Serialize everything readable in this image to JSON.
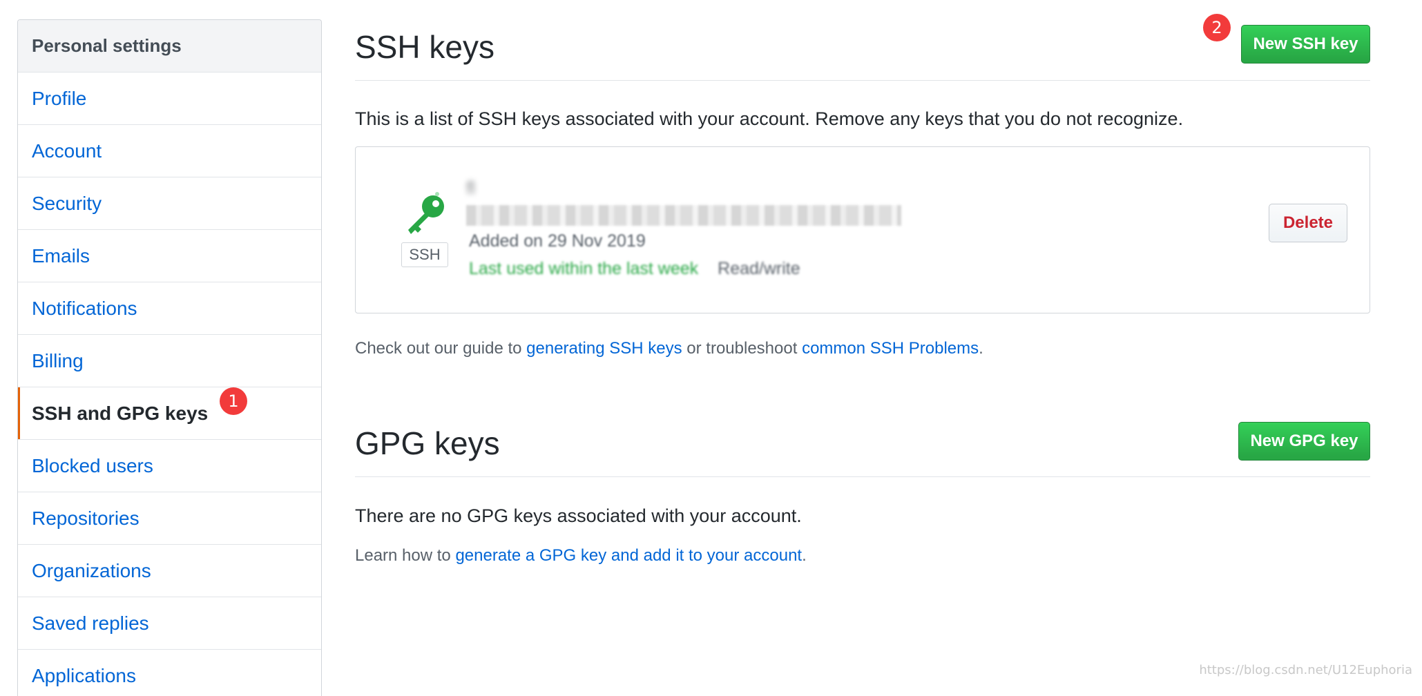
{
  "sidebar": {
    "header": "Personal settings",
    "items": [
      {
        "label": "Profile"
      },
      {
        "label": "Account"
      },
      {
        "label": "Security"
      },
      {
        "label": "Emails"
      },
      {
        "label": "Notifications"
      },
      {
        "label": "Billing"
      },
      {
        "label": "SSH and GPG keys",
        "selected": true
      },
      {
        "label": "Blocked users"
      },
      {
        "label": "Repositories"
      },
      {
        "label": "Organizations"
      },
      {
        "label": "Saved replies"
      },
      {
        "label": "Applications"
      }
    ]
  },
  "annotations": {
    "badge1": "1",
    "badge2": "2"
  },
  "ssh": {
    "title": "SSH keys",
    "new_button": "New SSH key",
    "description": "This is a list of SSH keys associated with your account. Remove any keys that you do not recognize.",
    "key": {
      "icon": "key-icon",
      "type_label": "SSH",
      "title": "fl",
      "added": "Added on 29 Nov 2019",
      "last_used": "Last used within the last week",
      "access": "Read/write",
      "delete_button": "Delete"
    },
    "guide": {
      "prefix": "Check out our guide to ",
      "link1": "generating SSH keys",
      "middle": " or troubleshoot ",
      "link2": "common SSH Problems",
      "suffix": "."
    }
  },
  "gpg": {
    "title": "GPG keys",
    "new_button": "New GPG key",
    "empty_message": "There are no GPG keys associated with your account.",
    "learn": {
      "prefix": "Learn how to ",
      "link": "generate a GPG key and add it to your account",
      "suffix": "."
    }
  },
  "watermark": "https://blog.csdn.net/U12Euphoria",
  "colors": {
    "accent_link": "#0366d6",
    "selected_marker": "#e36209",
    "primary_button": "#28a745",
    "danger": "#cb2431",
    "badge": "#f23b3b",
    "key_icon": "#28a745"
  }
}
